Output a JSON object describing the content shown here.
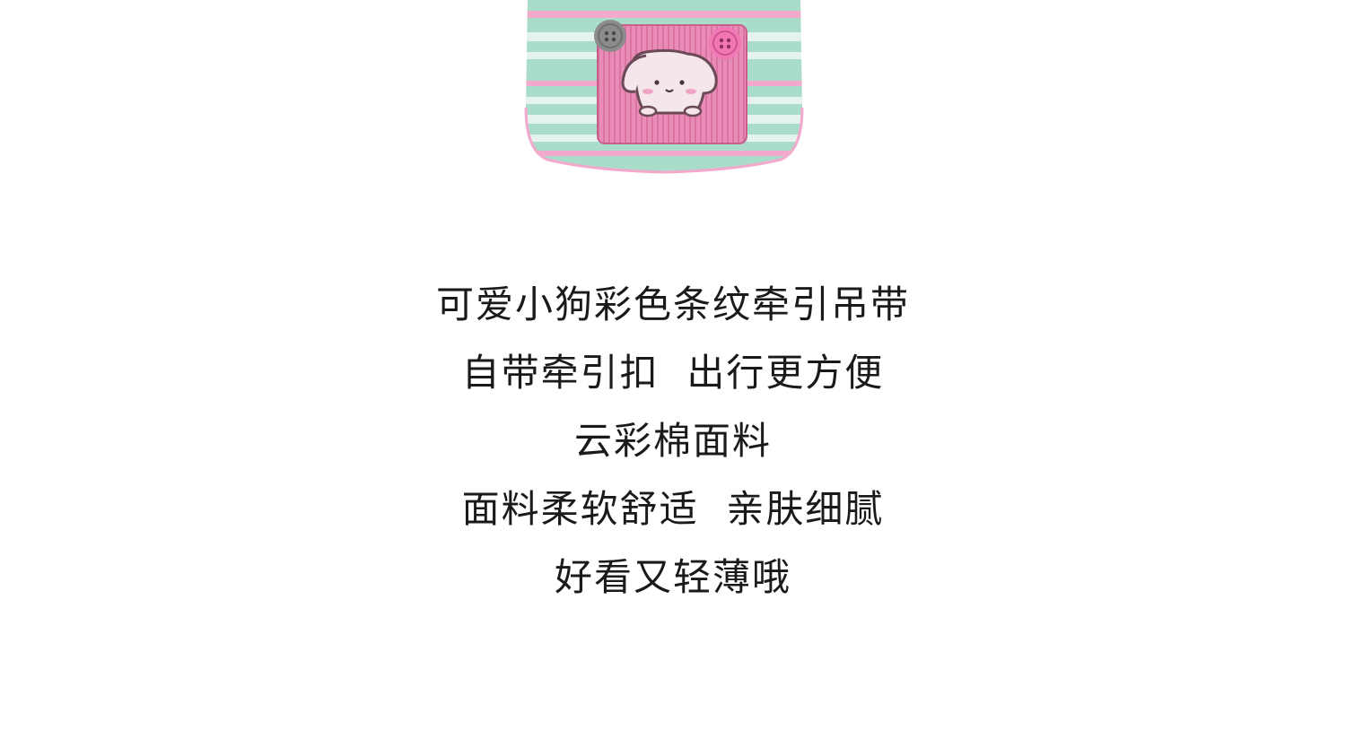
{
  "product_image": {
    "icon": "dog-pocket-illustration",
    "colors": {
      "stripe_green": "#a9dcc9",
      "stripe_light": "#e6f3ec",
      "stripe_pink": "#f3a9cc",
      "pocket_pink": "#e77fae",
      "button_gray": "#8c8c8c",
      "button_pink": "#f277b5",
      "dog_face": "#f5e6ec",
      "dog_outline": "#6b4a58"
    }
  },
  "copy": {
    "lines": [
      "可爱小狗彩色条纹牵引吊带",
      "自带牵引扣  出行更方便",
      "云彩棉面料",
      "面料柔软舒适  亲肤细腻",
      "好看又轻薄哦"
    ]
  }
}
